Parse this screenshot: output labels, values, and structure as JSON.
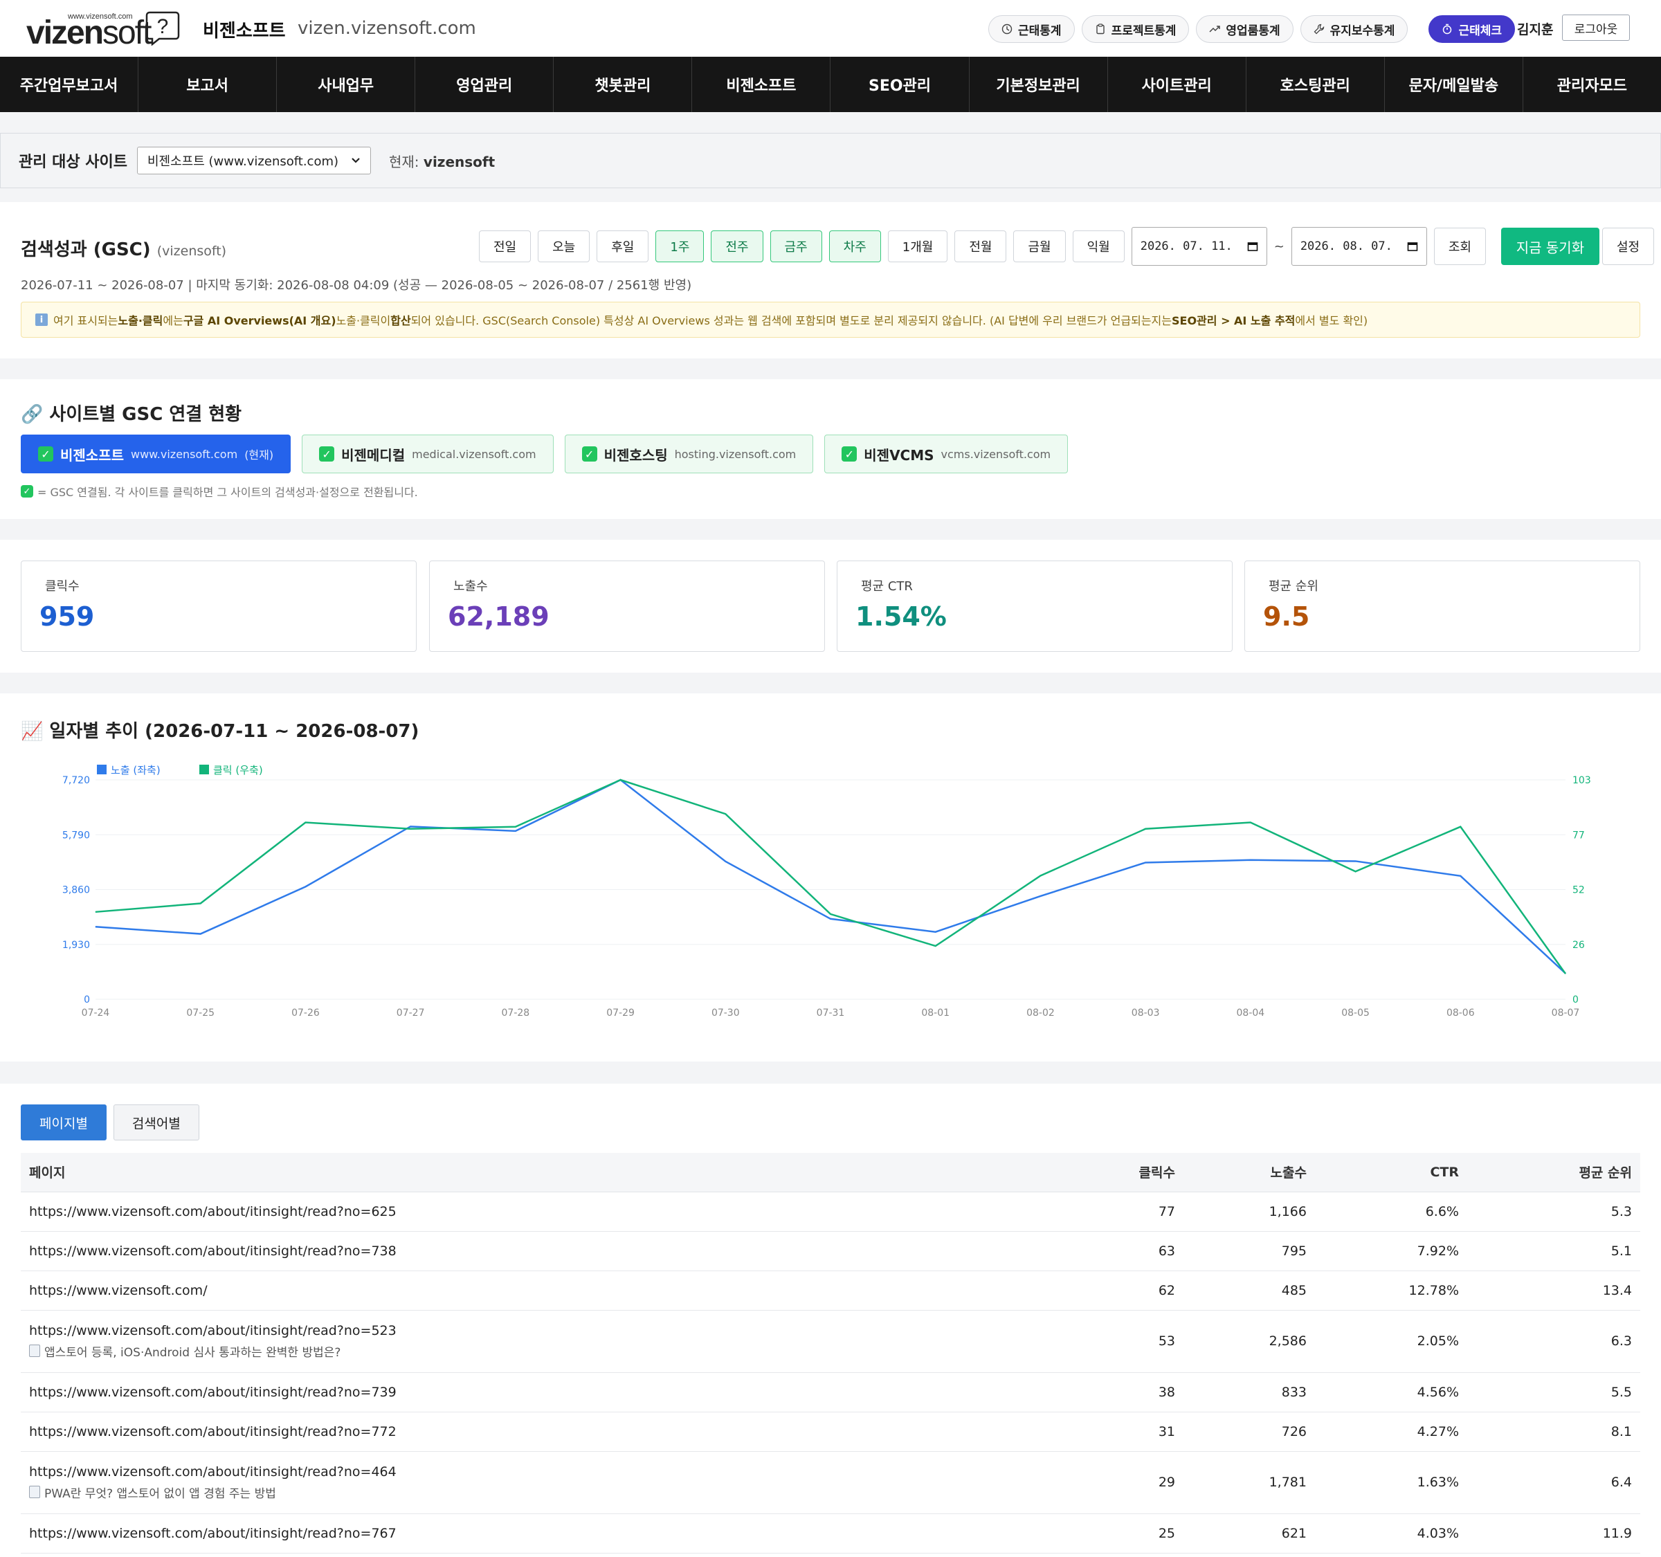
{
  "header": {
    "logo_url": "www.vizensoft.com",
    "logo_word_bold": "vizen",
    "logo_word_light": "soft",
    "company": "비젠소프트",
    "domain": "vizen.vizensoft.com",
    "pills": [
      {
        "label": "근태통계",
        "icon": "clock-icon"
      },
      {
        "label": "프로젝트통계",
        "icon": "clipboard-icon"
      },
      {
        "label": "영업룸통계",
        "icon": "trend-icon"
      },
      {
        "label": "유지보수통계",
        "icon": "wrench-icon"
      }
    ],
    "check_label": "근태체크",
    "user": "김지훈",
    "logout": "로그아웃"
  },
  "nav": [
    "주간업무보고서",
    "보고서",
    "사내업무",
    "영업관리",
    "챗봇관리",
    "비젠소프트",
    "SEO관리",
    "기본정보관리",
    "사이트관리",
    "호스팅관리",
    "문자/메일발송",
    "관리자모드"
  ],
  "site_bar": {
    "label": "관리 대상 사이트",
    "selected": "비젠소프트 (www.vizensoft.com)",
    "current_label": "현재:",
    "current_value": "vizensoft"
  },
  "gsc": {
    "title": "검색성과 (GSC)",
    "title_sub": "(vizensoft)",
    "period_buttons": [
      {
        "label": "전일",
        "green": false
      },
      {
        "label": "오늘",
        "green": false
      },
      {
        "label": "후일",
        "green": false
      },
      {
        "label": "1주",
        "green": true
      },
      {
        "label": "전주",
        "green": true
      },
      {
        "label": "금주",
        "green": true
      },
      {
        "label": "차주",
        "green": true
      },
      {
        "label": "1개월",
        "green": false
      },
      {
        "label": "전월",
        "green": false
      },
      {
        "label": "금월",
        "green": false
      },
      {
        "label": "익월",
        "green": false
      }
    ],
    "date_from": "2026. 07. 11.",
    "tilde": "~",
    "date_to": "2026. 08. 07.",
    "query_button": "조회",
    "sync_button": "지금 동기화",
    "settings_button": "설정",
    "meta": "2026-07-11 ~ 2026-08-07  |  마지막 동기화: 2026-08-08 04:09 (성공 — 2026-08-05 ~ 2026-08-07 / 2561행 반영)",
    "notice_parts": [
      "여기 표시되는 ",
      "노출·클릭",
      "에는 ",
      "구글 AI Overviews(AI 개요)",
      " 노출·클릭이 ",
      "합산",
      "되어 있습니다. GSC(Search Console) 특성상 AI Overviews 성과는 웹 검색에 포함되며 별도로 분리 제공되지 않습니다. (AI 답변에 우리 브랜드가 언급되는지는 ",
      "SEO관리 > AI 노출 추적",
      "에서 별도 확인)"
    ]
  },
  "connections": {
    "title": "🔗 사이트별 GSC 연결 현황",
    "chips": [
      {
        "name": "비젠소프트",
        "url": "www.vizensoft.com",
        "suffix": "(현재)",
        "active": true
      },
      {
        "name": "비젠메디컬",
        "url": "medical.vizensoft.com",
        "suffix": "",
        "active": false
      },
      {
        "name": "비젠호스팅",
        "url": "hosting.vizensoft.com",
        "suffix": "",
        "active": false
      },
      {
        "name": "비젠VCMS",
        "url": "vcms.vizensoft.com",
        "suffix": "",
        "active": false
      }
    ],
    "hint": "= GSC 연결됨. 각 사이트를 클릭하면 그 사이트의 검색성과·설정으로 전환됩니다."
  },
  "stats": [
    {
      "label": "클릭수",
      "value": "959",
      "color": "#1d5fd1"
    },
    {
      "label": "노출수",
      "value": "62,189",
      "color": "#6b3fb8"
    },
    {
      "label": "평균 CTR",
      "value": "1.54%",
      "color": "#0f8f7e"
    },
    {
      "label": "평균 순위",
      "value": "9.5",
      "color": "#b45309"
    }
  ],
  "chart_title": "📈 일자별 추이 (2026-07-11 ~ 2026-08-07)",
  "chart_data": {
    "type": "line",
    "x": [
      "07-24",
      "07-25",
      "07-26",
      "07-27",
      "07-28",
      "07-29",
      "07-30",
      "07-31",
      "08-01",
      "08-02",
      "08-03",
      "08-04",
      "08-05",
      "08-06",
      "08-07"
    ],
    "series": [
      {
        "name": "노출 (좌축)",
        "axis": "left",
        "color": "#2f7bea",
        "values": [
          2550,
          2300,
          3960,
          6080,
          5920,
          7720,
          4850,
          2830,
          2370,
          3630,
          4810,
          4900,
          4860,
          4340,
          910
        ]
      },
      {
        "name": "클릭 (우축)",
        "axis": "right",
        "color": "#12b47a",
        "values": [
          41,
          45,
          83,
          80,
          81,
          103,
          87,
          40,
          25,
          58,
          80,
          83,
          60,
          81,
          12
        ]
      }
    ],
    "left_ticks": [
      "0",
      "1,930",
      "3,860",
      "5,790",
      "7,720"
    ],
    "right_ticks": [
      "0",
      "26",
      "52",
      "77",
      "103"
    ],
    "ylim_left": [
      0,
      7720
    ],
    "ylim_right": [
      0,
      103
    ],
    "legend": "top-left",
    "grid": true
  },
  "table": {
    "tabs": [
      {
        "label": "페이지별",
        "active": true
      },
      {
        "label": "검색어별",
        "active": false
      }
    ],
    "headers": [
      "페이지",
      "클릭수",
      "노출수",
      "CTR",
      "평균 순위"
    ],
    "rows": [
      {
        "page": "https://www.vizensoft.com/about/itinsight/read?no=625",
        "sub": "",
        "clicks": "77",
        "impr": "1,166",
        "ctr": "6.6%",
        "pos": "5.3"
      },
      {
        "page": "https://www.vizensoft.com/about/itinsight/read?no=738",
        "sub": "",
        "clicks": "63",
        "impr": "795",
        "ctr": "7.92%",
        "pos": "5.1"
      },
      {
        "page": "https://www.vizensoft.com/",
        "sub": "",
        "clicks": "62",
        "impr": "485",
        "ctr": "12.78%",
        "pos": "13.4"
      },
      {
        "page": "https://www.vizensoft.com/about/itinsight/read?no=523",
        "sub": "앱스토어 등록, iOS·Android 심사 통과하는 완벽한 방법은?",
        "clicks": "53",
        "impr": "2,586",
        "ctr": "2.05%",
        "pos": "6.3"
      },
      {
        "page": "https://www.vizensoft.com/about/itinsight/read?no=739",
        "sub": "",
        "clicks": "38",
        "impr": "833",
        "ctr": "4.56%",
        "pos": "5.5"
      },
      {
        "page": "https://www.vizensoft.com/about/itinsight/read?no=772",
        "sub": "",
        "clicks": "31",
        "impr": "726",
        "ctr": "4.27%",
        "pos": "8.1"
      },
      {
        "page": "https://www.vizensoft.com/about/itinsight/read?no=464",
        "sub": "PWA란 무엇? 앱스토어 없이 앱 경험 주는 방법",
        "clicks": "29",
        "impr": "1,781",
        "ctr": "1.63%",
        "pos": "6.4"
      },
      {
        "page": "https://www.vizensoft.com/about/itinsight/read?no=767",
        "sub": "",
        "clicks": "25",
        "impr": "621",
        "ctr": "4.03%",
        "pos": "11.9"
      }
    ]
  }
}
